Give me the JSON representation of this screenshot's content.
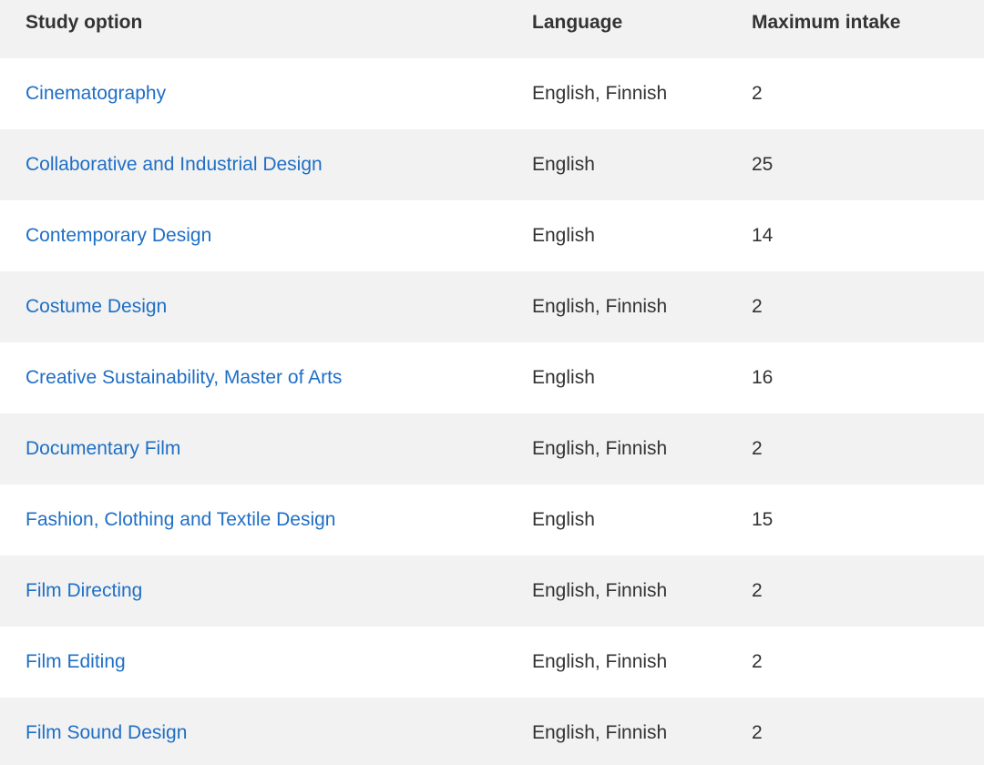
{
  "table": {
    "headers": {
      "study_option": "Study option",
      "language": "Language",
      "maximum_intake": "Maximum intake"
    },
    "rows": [
      {
        "study_option": "Cinematography",
        "language": "English, Finnish",
        "maximum_intake": "2"
      },
      {
        "study_option": "Collaborative and Industrial Design",
        "language": "English",
        "maximum_intake": "25"
      },
      {
        "study_option": "Contemporary Design",
        "language": "English",
        "maximum_intake": "14"
      },
      {
        "study_option": "Costume Design",
        "language": "English, Finnish",
        "maximum_intake": "2"
      },
      {
        "study_option": "Creative Sustainability, Master of Arts",
        "language": "English",
        "maximum_intake": "16"
      },
      {
        "study_option": "Documentary Film",
        "language": "English, Finnish",
        "maximum_intake": "2"
      },
      {
        "study_option": "Fashion, Clothing and Textile Design",
        "language": "English",
        "maximum_intake": "15"
      },
      {
        "study_option": "Film Directing",
        "language": "English, Finnish",
        "maximum_intake": "2"
      },
      {
        "study_option": "Film Editing",
        "language": "English, Finnish",
        "maximum_intake": "2"
      },
      {
        "study_option": "Film Sound Design",
        "language": "English, Finnish",
        "maximum_intake": "2"
      }
    ]
  },
  "colors": {
    "link": "#1f6fc5",
    "text": "#333333",
    "stripe": "#f2f2f2"
  }
}
